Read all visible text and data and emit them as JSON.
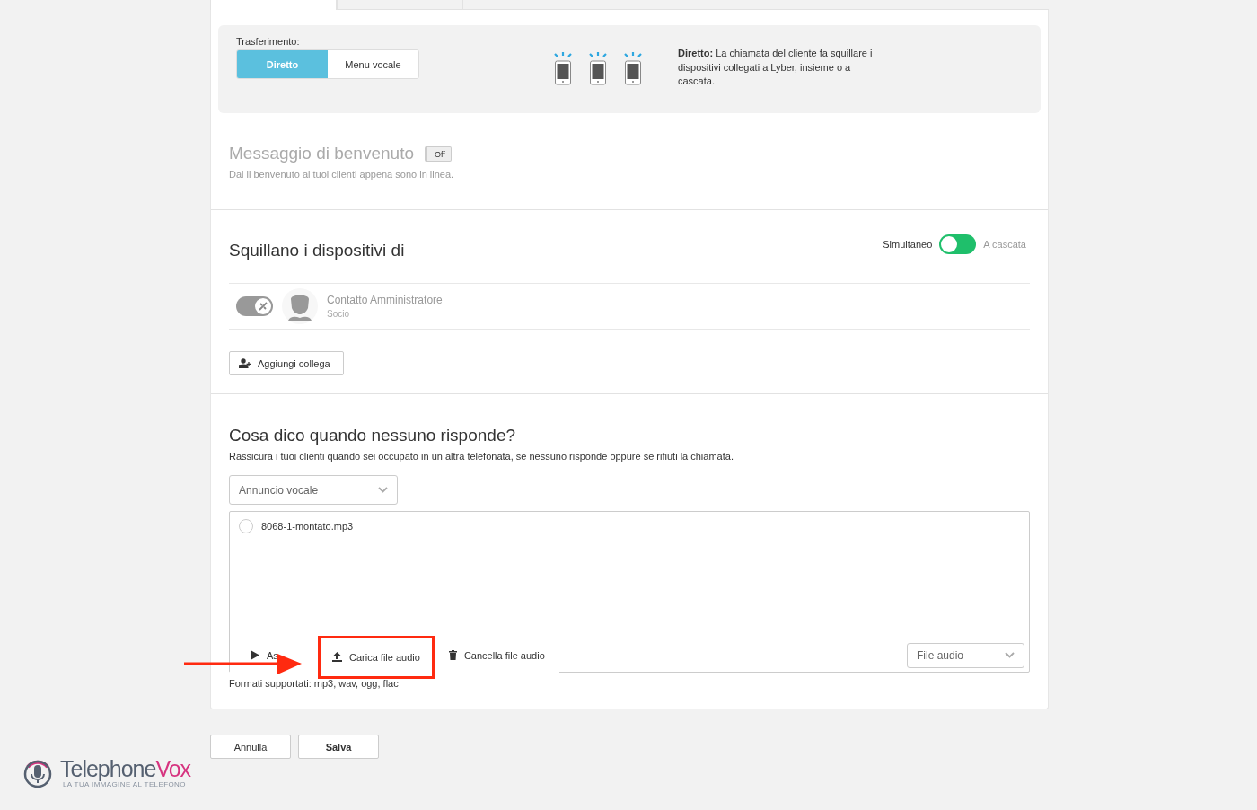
{
  "tabs": [
    {
      "selected": true
    },
    {
      "selected": false
    }
  ],
  "transfer": {
    "label": "Trasferimento:",
    "options": [
      {
        "label": "Diretto",
        "selected": true
      },
      {
        "label": "Menu vocale",
        "selected": false
      }
    ],
    "description": "**Diretto:** La chiamata del cliente fa squillare i dispositivi collegati a Lyber, insieme o a cascata."
  },
  "welcome": {
    "title": "Messaggio di benvenuto",
    "toggle": {
      "label": "Off",
      "on": false
    },
    "subtitle": "Dai il benvenuto ai tuoi clienti appena sono in linea."
  },
  "ring": {
    "title": "Squillano i dispositivi di",
    "mode_left": "Simultaneo",
    "mode_right": "A cascata",
    "cascade": false,
    "contacts": [
      {
        "name": "Contatto Amministratore",
        "role": "Socio",
        "muted": true
      }
    ],
    "add_button": "Aggiungi collega"
  },
  "no_answer": {
    "title": "Cosa dico quando nessuno risponde?",
    "description": "Rassicura i tuoi clienti quando sei occupato in un altra telefonata, se nessuno risponde oppure se rifiuti la chiamata.",
    "type_select": "Annuncio vocale",
    "files": [
      {
        "name": "8068-1-montato.mp3",
        "selected": false
      }
    ],
    "actions": [
      {
        "kind": "play",
        "label": "As"
      },
      {
        "kind": "upload",
        "label": "Carica file audio",
        "highlighted": true
      },
      {
        "kind": "delete",
        "label": "Cancella file audio"
      }
    ],
    "source_select": "File audio",
    "formats": "Formati supportati: mp3, wav, ogg, flac"
  },
  "footer": {
    "buttons": [
      {
        "label": "Annulla",
        "primary": false
      },
      {
        "label": "Salva",
        "primary": true
      }
    ]
  },
  "logo": {
    "name_a": "Telephone",
    "name_b": "Vox",
    "tagline": "LA TUA IMMAGINE AL TELEFONO"
  }
}
